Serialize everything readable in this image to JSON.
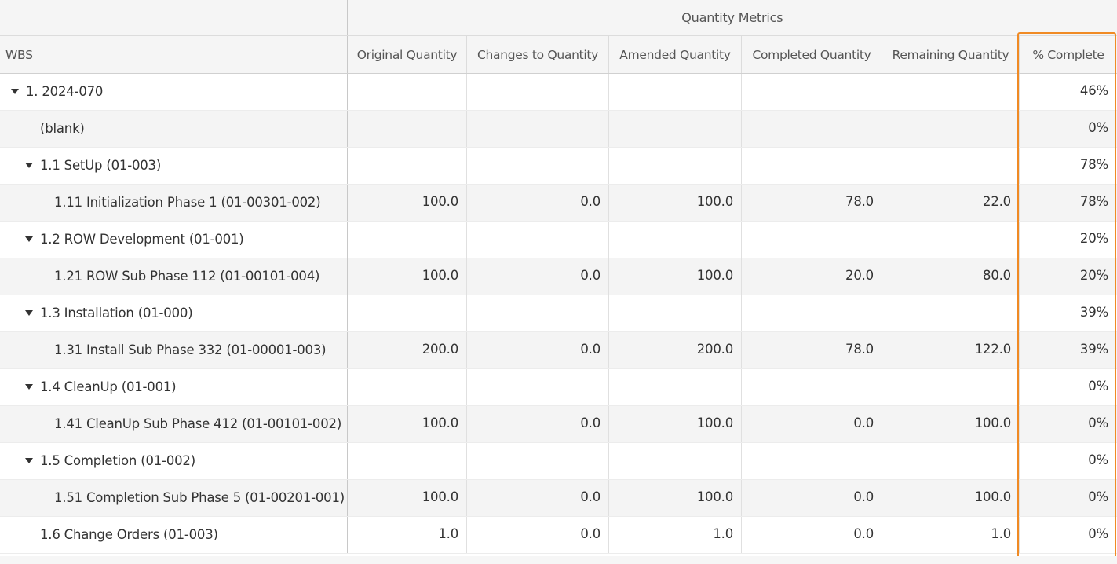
{
  "header": {
    "group_label": "Quantity Metrics",
    "columns": [
      "WBS",
      "Original Quantity",
      "Changes to Quantity",
      "Amended Quantity",
      "Completed Quantity",
      "Remaining Quantity",
      "% Complete"
    ]
  },
  "rows": [
    {
      "level": 0,
      "expandable": true,
      "label": "1. 2024-070",
      "original": "",
      "changes": "",
      "amended": "",
      "completed": "",
      "remaining": "",
      "pct": "46%"
    },
    {
      "level": 1,
      "expandable": false,
      "label": "(blank)",
      "original": "",
      "changes": "",
      "amended": "",
      "completed": "",
      "remaining": "",
      "pct": "0%"
    },
    {
      "level": 1,
      "expandable": true,
      "label": "1.1 SetUp (01-003)",
      "original": "",
      "changes": "",
      "amended": "",
      "completed": "",
      "remaining": "",
      "pct": "78%"
    },
    {
      "level": 2,
      "expandable": false,
      "label": "1.11 Initialization Phase 1 (01-00301-002)",
      "original": "100.0",
      "changes": "0.0",
      "amended": "100.0",
      "completed": "78.0",
      "remaining": "22.0",
      "pct": "78%"
    },
    {
      "level": 1,
      "expandable": true,
      "label": "1.2 ROW Development (01-001)",
      "original": "",
      "changes": "",
      "amended": "",
      "completed": "",
      "remaining": "",
      "pct": "20%"
    },
    {
      "level": 2,
      "expandable": false,
      "label": "1.21 ROW Sub Phase 112 (01-00101-004)",
      "original": "100.0",
      "changes": "0.0",
      "amended": "100.0",
      "completed": "20.0",
      "remaining": "80.0",
      "pct": "20%"
    },
    {
      "level": 1,
      "expandable": true,
      "label": "1.3 Installation (01-000)",
      "original": "",
      "changes": "",
      "amended": "",
      "completed": "",
      "remaining": "",
      "pct": "39%"
    },
    {
      "level": 2,
      "expandable": false,
      "label": "1.31 Install Sub Phase 332 (01-00001-003)",
      "original": "200.0",
      "changes": "0.0",
      "amended": "200.0",
      "completed": "78.0",
      "remaining": "122.0",
      "pct": "39%"
    },
    {
      "level": 1,
      "expandable": true,
      "label": "1.4 CleanUp (01-001)",
      "original": "",
      "changes": "",
      "amended": "",
      "completed": "",
      "remaining": "",
      "pct": "0%"
    },
    {
      "level": 2,
      "expandable": false,
      "label": "1.41 CleanUp Sub Phase 412 (01-00101-002)",
      "original": "100.0",
      "changes": "0.0",
      "amended": "100.0",
      "completed": "0.0",
      "remaining": "100.0",
      "pct": "0%"
    },
    {
      "level": 1,
      "expandable": true,
      "label": "1.5 Completion (01-002)",
      "original": "",
      "changes": "",
      "amended": "",
      "completed": "",
      "remaining": "",
      "pct": "0%"
    },
    {
      "level": 2,
      "expandable": false,
      "label": "1.51 Completion Sub Phase 5 (01-00201-001)",
      "original": "100.0",
      "changes": "0.0",
      "amended": "100.0",
      "completed": "0.0",
      "remaining": "100.0",
      "pct": "0%"
    },
    {
      "level": 1,
      "expandable": false,
      "label": "1.6 Change Orders (01-003)",
      "original": "1.0",
      "changes": "0.0",
      "amended": "1.0",
      "completed": "0.0",
      "remaining": "1.0",
      "pct": "0%"
    }
  ],
  "colors": {
    "highlight_border": "#f08a24",
    "header_bg": "#f5f5f5",
    "alt_row_bg": "#f4f4f4",
    "text": "#333333"
  }
}
